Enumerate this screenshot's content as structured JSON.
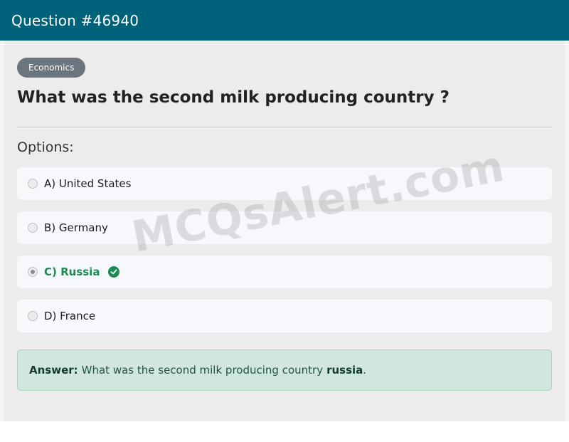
{
  "header": {
    "title": "Question #46940"
  },
  "category": {
    "label": "Economics"
  },
  "question": {
    "text": "What was the second milk producing country ?"
  },
  "options_label": "Options:",
  "options": [
    {
      "label": "A) United States",
      "selected": false,
      "correct": false
    },
    {
      "label": "B) Germany",
      "selected": false,
      "correct": false
    },
    {
      "label": "C) Russia",
      "selected": true,
      "correct": true
    },
    {
      "label": "D) France",
      "selected": false,
      "correct": false
    }
  ],
  "answer": {
    "prefix": "Answer:",
    "text": "What was the second milk producing country",
    "value": "russia",
    "suffix": "."
  },
  "watermark": "MCQsAlert.com",
  "colors": {
    "header_bg": "#00627a",
    "correct": "#1e8a55",
    "answer_bg": "#d1e6dd",
    "tag_bg": "#6c757d"
  },
  "icons": {
    "correct": "check-circle-icon"
  }
}
